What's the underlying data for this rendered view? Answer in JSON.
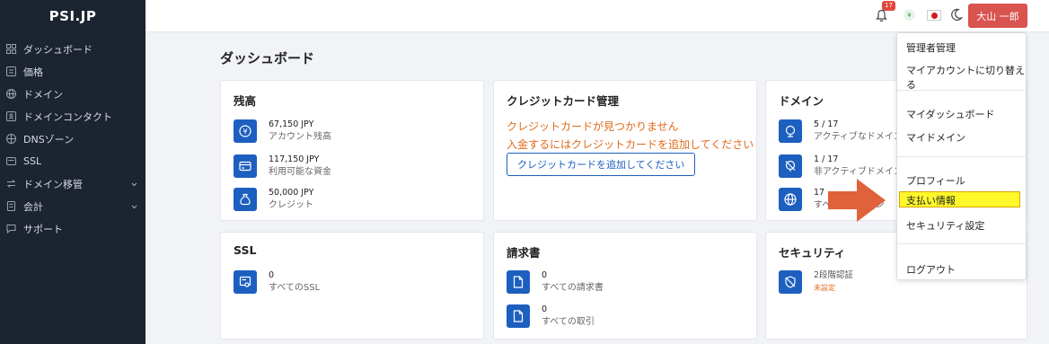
{
  "brand": "PSI.JP",
  "sidebar": {
    "items": [
      {
        "label": "ダッシュボード",
        "icon": "dashboard-icon"
      },
      {
        "label": "価格",
        "icon": "price-icon"
      },
      {
        "label": "ドメイン",
        "icon": "globe-icon"
      },
      {
        "label": "ドメインコンタクト",
        "icon": "contact-icon"
      },
      {
        "label": "DNSゾーン",
        "icon": "dns-icon"
      },
      {
        "label": "SSL",
        "icon": "ssl-icon"
      },
      {
        "label": "ドメイン移管",
        "icon": "transfer-icon",
        "chevron": true
      },
      {
        "label": "会計",
        "icon": "accounting-icon",
        "chevron": true
      },
      {
        "label": "サポート",
        "icon": "support-icon"
      }
    ]
  },
  "header": {
    "notifications": "17",
    "currency_symbol": "¥",
    "user_name": "大山 一郎"
  },
  "main": {
    "title": "ダッシュボード"
  },
  "cards": {
    "balance": {
      "title": "残高",
      "stats": [
        {
          "value": "67,150 JPY",
          "label": "アカウント残高"
        },
        {
          "value": "117,150 JPY",
          "label": "利用可能な資金"
        },
        {
          "value": "50,000 JPY",
          "label": "クレジット"
        }
      ]
    },
    "credit_card": {
      "title": "クレジットカード管理",
      "warning1": "クレジットカードが見つかりません",
      "warning2": "入金するにはクレジットカードを追加してください",
      "button": "クレジットカードを追加してください"
    },
    "domain": {
      "title": "ドメイン",
      "stats": [
        {
          "value": "5 / 17",
          "label": "アクティブなドメイン"
        },
        {
          "value": "1 / 17",
          "label": "非アクティブドメイン"
        },
        {
          "value": "17",
          "label": "すべてのドメイン"
        }
      ]
    },
    "ssl": {
      "title": "SSL",
      "stats": [
        {
          "value": "0",
          "label": "すべてのSSL"
        }
      ]
    },
    "invoice": {
      "title": "請求書",
      "stats": [
        {
          "value": "0",
          "label": "すべての請求書"
        },
        {
          "value": "0",
          "label": "すべての取引"
        }
      ]
    },
    "security": {
      "title": "セキュリティ",
      "stats": [
        {
          "value": "2段階認証",
          "label": "未設定"
        }
      ]
    }
  },
  "dropdown": {
    "items": [
      "管理者管理",
      "マイアカウントに切り替える",
      "マイダッシュボード",
      "マイドメイン",
      "プロフィール",
      "支払い情報",
      "セキュリティ設定",
      "ログアウト"
    ]
  },
  "colors": {
    "primary": "#1d5fbf",
    "sidebar": "#1c2431",
    "warning": "#e06a1a",
    "user_button": "#d9534f",
    "highlight": "#fff82b",
    "arrow": "#e0623a"
  }
}
